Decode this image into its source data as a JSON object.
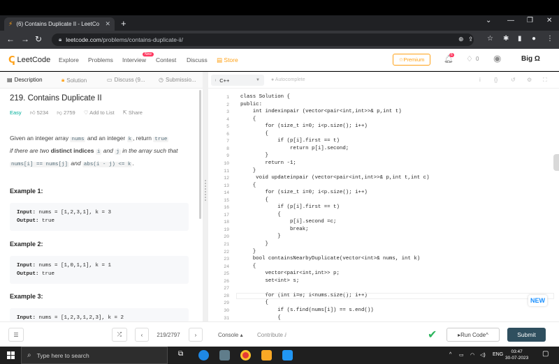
{
  "browser": {
    "tab_title": "(6) Contains Duplicate II - LeetCo",
    "url_host": "leetcode.com",
    "url_path": "/problems/contains-duplicate-ii/"
  },
  "nav": {
    "logo": "LeetCode",
    "links": [
      "Explore",
      "Problems",
      "Interview",
      "Contest",
      "Discuss"
    ],
    "new_badge": "New",
    "store": "Store",
    "premium": "Premium",
    "notif_count": "6",
    "coins": "0",
    "big_o": "Big Ω"
  },
  "left_tabs": [
    "Description",
    "Solution",
    "Discuss (9...",
    "Submissio..."
  ],
  "problem": {
    "title": "219. Contains Duplicate II",
    "difficulty": "Easy",
    "likes": "5234",
    "dislikes": "2759",
    "add_to_list": "Add to List",
    "share": "Share",
    "desc_1": "Given an integer array ",
    "desc_nums": "nums",
    "desc_2": " and an integer ",
    "desc_k": "k",
    "desc_3": ", return ",
    "desc_true": "true",
    "desc_4": "if there are two ",
    "desc_distinct": "distinct indices",
    "desc_i": "i",
    "desc_and": " and ",
    "desc_j": "j",
    "desc_5": " in the array such that ",
    "desc_cond1": "nums[i] == nums[j]",
    "desc_and2": " and ",
    "desc_cond2": "abs(i - j) <= k",
    "desc_end": "."
  },
  "examples": [
    {
      "heading": "Example 1:",
      "input": "nums = [1,2,3,1], k = 3",
      "output": "true"
    },
    {
      "heading": "Example 2:",
      "input": "nums = [1,0,1,1], k = 1",
      "output": "true"
    },
    {
      "heading": "Example 3:",
      "input": "nums = [1,2,3,1,2,3], k = 2"
    }
  ],
  "labels": {
    "input": "Input:",
    "output": "Output:"
  },
  "editor": {
    "language": "C++",
    "autocomplete": "Autocomplete"
  },
  "code_lines": [
    "class Solution {",
    "public:",
    "    int indexinpair (vector<pair<int,int>>& p,int t)",
    "    {",
    "        for (size_t i=0; i<p.size(); i++)",
    "        {",
    "            if (p[i].first == t)",
    "                return p[i].second;",
    "        }",
    "        return -1;",
    "    }",
    "     void updateinpair (vector<pair<int,int>>& p,int t,int c)",
    "    {",
    "        for (size_t i=0; i<p.size(); i++)",
    "        {",
    "            if (p[i].first == t)",
    "            {",
    "                p[i].second =c;",
    "                break;",
    "            }",
    "        }",
    "    }",
    "    bool containsNearbyDuplicate(vector<int>& nums, int k)",
    "    {",
    "        vector<pair<int,int>> p;",
    "        set<int> s;",
    "",
    "        for (int i=0; i<nums.size(); i++)",
    "        {",
    "            if (s.find(nums[i]) == s.end())",
    "            {"
  ],
  "line_numbers": [
    "1",
    "2",
    "3",
    "4",
    "5",
    "6",
    "7",
    "8",
    "9",
    "10",
    "11",
    "12",
    "13",
    "14",
    "15",
    "16",
    "17",
    "18",
    "19",
    "20",
    "21",
    "22",
    "23",
    "24",
    "25",
    "26",
    "27",
    "28",
    "29",
    "30",
    "31"
  ],
  "new_button": "NEW",
  "bottom": {
    "pager": "219/2797",
    "console": "Console",
    "contribute": "Contribute",
    "run_code": "Run Code",
    "submit": "Submit"
  },
  "taskbar": {
    "search_placeholder": "Type here to search",
    "lang": "ENG",
    "time": "03:47",
    "date": "30-07-2023"
  }
}
